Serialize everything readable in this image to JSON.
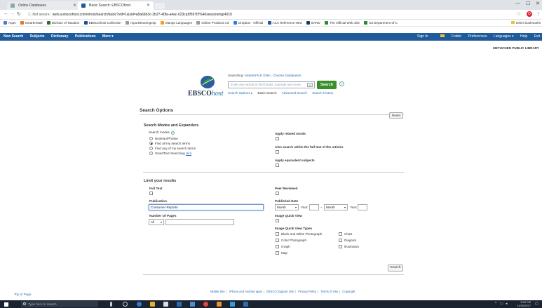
{
  "browser": {
    "tabs": [
      {
        "label": "Online Databases",
        "active": false
      },
      {
        "label": "Basic Search: EBSCOhost",
        "active": true
      }
    ],
    "secure_label": "Not secure",
    "url": "web.a.ebscohost.com/ehost/search/basic?vid=1&sid=a8a66b3c-2b27-40fa-a4ac-023ca5f597f2%40sessionmgr4010",
    "bookmarks": [
      {
        "label": "Apps",
        "color": "#4a7bd0"
      },
      {
        "label": "SmarterMail",
        "color": "#e07a1f"
      },
      {
        "label": "Division of Taxation",
        "color": "#2c6e2c"
      },
      {
        "label": "EBSCOhost Collection",
        "color": "#1d4f91"
      },
      {
        "label": "reportsleaningexp",
        "color": "#999999"
      },
      {
        "label": "Mango Languages",
        "color": "#f0a020"
      },
      {
        "label": "Online Products Ad",
        "color": "#999999"
      },
      {
        "label": "Dropbox - Official",
        "color": "#2a7de1"
      },
      {
        "label": "ACA Reference New",
        "color": "#1f5a9a"
      },
      {
        "label": "BARD",
        "color": "#1f3b5a"
      },
      {
        "label": "The Official Web Site",
        "color": "#2a8a2a"
      },
      {
        "label": "NJ Department of C",
        "color": "#2a8a2a"
      }
    ],
    "other_bookmarks": "Other bookmarks"
  },
  "nav": {
    "left": [
      "New Search",
      "Subjects",
      "Dictionary",
      "Publications",
      "More ▾"
    ],
    "right": {
      "sign_in": "Sign In",
      "folder": "Folder",
      "preferences": "Preferences",
      "languages": "Languages ▾",
      "help": "Help",
      "exit": "Exit"
    }
  },
  "library_name": "METUCHEN PUBLIC LIBRARY",
  "logo": {
    "brand": "EBSCO",
    "brand_suffix": "host"
  },
  "search": {
    "searching_label": "Searching:",
    "database": "MasterFILE Elite",
    "choose_databases": "Choose Databases",
    "placeholder": "Enter any words to find books, journals and more",
    "button": "Search",
    "help": "?",
    "links": {
      "options": "Search Options ▸",
      "basic": "Basic Search",
      "advanced": "Advanced Search",
      "history": "Search History"
    }
  },
  "options": {
    "title": "Search Options",
    "reset": "Reset",
    "modes": {
      "heading": "Search Modes and Expanders",
      "search_modes_label": "Search modes",
      "help": "?",
      "radios": [
        {
          "label": "Boolean/Phrase",
          "checked": false
        },
        {
          "label": "Find all my search terms",
          "checked": true
        },
        {
          "label": "Find any of my search terms",
          "checked": false
        },
        {
          "label": "SmartText Searching",
          "checked": false
        }
      ],
      "hint": "Hint",
      "apply_related": "Apply related words",
      "also_search_fulltext": "Also search within the full text of the articles",
      "apply_equivalent": "Apply equivalent subjects"
    },
    "limits": {
      "heading": "Limit your results",
      "full_text": "Full Text",
      "peer_reviewed": "Peer Reviewed",
      "publication_label": "Publication",
      "publication_value": "Consumer Reports",
      "published_date_label": "Published Date",
      "month1": "Month",
      "year_label1": "Year:",
      "dash": "–",
      "month2": "Month",
      "year_label2": "Year:",
      "pages_label": "Number Of Pages",
      "pages_value": "All",
      "image_quick_view": "Image Quick View",
      "image_types_label": "Image Quick View Types",
      "image_types_left": [
        "Black and White Photograph",
        "Color Photograph",
        "Graph",
        "Map"
      ],
      "image_types_right": [
        "Chart",
        "Diagram",
        "Illustration"
      ]
    },
    "search_button": "Search"
  },
  "footer": {
    "top_of_page": "Top of Page",
    "links": [
      "Mobile Site",
      "iPhone and Android apps",
      "EBSCO Support Site",
      "Privacy Policy",
      "Terms of Use",
      "Copyright"
    ]
  },
  "taskbar": {
    "search_placeholder": "Type here to search",
    "time": "3:30 PM",
    "date": "11/20/2017"
  }
}
